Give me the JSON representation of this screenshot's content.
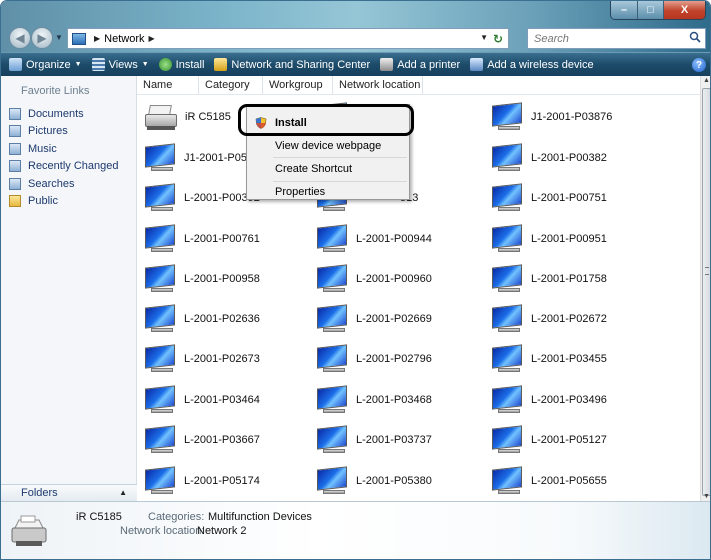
{
  "title_bar": {
    "buttons": {
      "minimize": "–",
      "maximize": "□",
      "close": "X"
    }
  },
  "address_bar": {
    "crumbs": [
      "Network"
    ],
    "search_placeholder": "Search"
  },
  "command_bar": {
    "organize": "Organize",
    "views": "Views",
    "install": "Install",
    "network_center": "Network and Sharing Center",
    "add_printer": "Add a printer",
    "add_wireless": "Add a wireless device",
    "help": "?"
  },
  "nav_pane": {
    "favorites_title": "Favorite Links",
    "favorites": [
      {
        "label": "Documents",
        "icon": "documents-icon"
      },
      {
        "label": "Pictures",
        "icon": "pictures-icon"
      },
      {
        "label": "Music",
        "icon": "music-icon"
      },
      {
        "label": "Recently Changed",
        "icon": "recent-icon"
      },
      {
        "label": "Searches",
        "icon": "search-folder-icon"
      },
      {
        "label": "Public",
        "icon": "public-folder-icon"
      }
    ],
    "folders_label": "Folders"
  },
  "columns": [
    "Name",
    "Category",
    "Workgroup",
    "Network location"
  ],
  "items": [
    {
      "label": "iR C5185",
      "icon": "printer-icon"
    },
    {
      "label": "",
      "icon": "computer-icon"
    },
    {
      "label": "J1-2001-P03876",
      "icon": "computer-icon"
    },
    {
      "label": "J1-2001-P05651",
      "icon": "computer-icon"
    },
    {
      "label": "",
      "icon": "computer-icon"
    },
    {
      "label": "L-2001-P00382",
      "icon": "computer-icon"
    },
    {
      "label": "L-2001-P00392",
      "icon": "computer-icon"
    },
    {
      "label": "513",
      "icon": "computer-icon"
    },
    {
      "label": "L-2001-P00751",
      "icon": "computer-icon"
    },
    {
      "label": "L-2001-P00761",
      "icon": "computer-icon"
    },
    {
      "label": "L-2001-P00944",
      "icon": "computer-icon"
    },
    {
      "label": "L-2001-P00951",
      "icon": "computer-icon"
    },
    {
      "label": "L-2001-P00958",
      "icon": "computer-icon"
    },
    {
      "label": "L-2001-P00960",
      "icon": "computer-icon"
    },
    {
      "label": "L-2001-P01758",
      "icon": "computer-icon"
    },
    {
      "label": "L-2001-P02636",
      "icon": "computer-icon"
    },
    {
      "label": "L-2001-P02669",
      "icon": "computer-icon"
    },
    {
      "label": "L-2001-P02672",
      "icon": "computer-icon"
    },
    {
      "label": "L-2001-P02673",
      "icon": "computer-icon"
    },
    {
      "label": "L-2001-P02796",
      "icon": "computer-icon"
    },
    {
      "label": "L-2001-P03455",
      "icon": "computer-icon"
    },
    {
      "label": "L-2001-P03464",
      "icon": "computer-icon"
    },
    {
      "label": "L-2001-P03468",
      "icon": "computer-icon"
    },
    {
      "label": "L-2001-P03496",
      "icon": "computer-icon"
    },
    {
      "label": "L-2001-P03667",
      "icon": "computer-icon"
    },
    {
      "label": "L-2001-P03737",
      "icon": "computer-icon"
    },
    {
      "label": "L-2001-P05127",
      "icon": "computer-icon"
    },
    {
      "label": "L-2001-P05174",
      "icon": "computer-icon"
    },
    {
      "label": "L-2001-P05380",
      "icon": "computer-icon"
    },
    {
      "label": "L-2001-P05655",
      "icon": "computer-icon"
    }
  ],
  "context_menu": {
    "items": [
      "Install",
      "View device webpage",
      "Create Shortcut",
      "Properties"
    ]
  },
  "details": {
    "name": "iR C5185",
    "categories_label": "Categories:",
    "categories_value": "Multifunction Devices",
    "location_label": "Network location:",
    "location_value": "Network 2"
  },
  "colors": {
    "glass": "#7ab3c9",
    "command_bar": "#1d4b6a",
    "link_text": "#1e3a6f"
  }
}
